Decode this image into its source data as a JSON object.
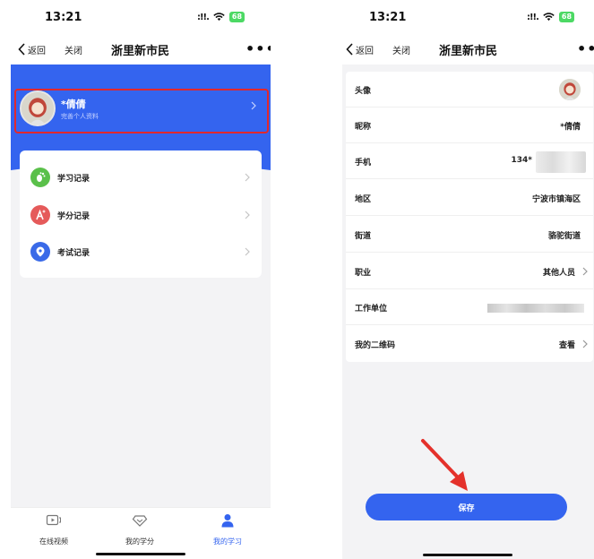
{
  "left_screen": {
    "status": {
      "time": "13:21",
      "signal": ":!!.",
      "battery": "68"
    },
    "nav": {
      "back_label": "返回",
      "close_label": "关闭",
      "title": "浙里新市民",
      "more": "•••"
    },
    "profile": {
      "name": "*倩倩",
      "subtitle": "完善个人资料",
      "avatar_icon": "user-avatar-icon"
    },
    "menu": [
      {
        "label": "学习记录",
        "icon": "footprint-icon",
        "color": "#5ac04a"
      },
      {
        "label": "学分记录",
        "icon": "credit-a-icon",
        "color": "#e55a5a"
      },
      {
        "label": "考试记录",
        "icon": "exam-pin-icon",
        "color": "#3a6ae8"
      }
    ],
    "tabs": [
      {
        "label": "在线视频",
        "icon": "video-icon",
        "active": false
      },
      {
        "label": "我的学分",
        "icon": "diamond-icon",
        "active": false
      },
      {
        "label": "我的学习",
        "icon": "person-icon",
        "active": true
      }
    ],
    "colors": {
      "brand_blue": "#3464ef",
      "highlight_red": "#e2282c"
    }
  },
  "right_screen": {
    "status": {
      "time": "13:21",
      "signal": ":!!.",
      "battery": "68"
    },
    "nav": {
      "back_label": "返回",
      "close_label": "关闭",
      "title": "浙里新市民",
      "more": "•••"
    },
    "form": {
      "avatar_label": "头像",
      "nickname_label": "昵称",
      "nickname_value": "*倩倩",
      "phone_label": "手机",
      "phone_value": "134*",
      "region_label": "地区",
      "region_value": "宁波市镇海区",
      "street_label": "街道",
      "street_value": "骆驼街道",
      "job_label": "职业",
      "job_value": "其他人员",
      "work_label": "工作单位",
      "qrcode_label": "我的二维码",
      "qrcode_value": "查看"
    },
    "save_label": "保存",
    "arrow_icon": "red-arrow-icon"
  }
}
